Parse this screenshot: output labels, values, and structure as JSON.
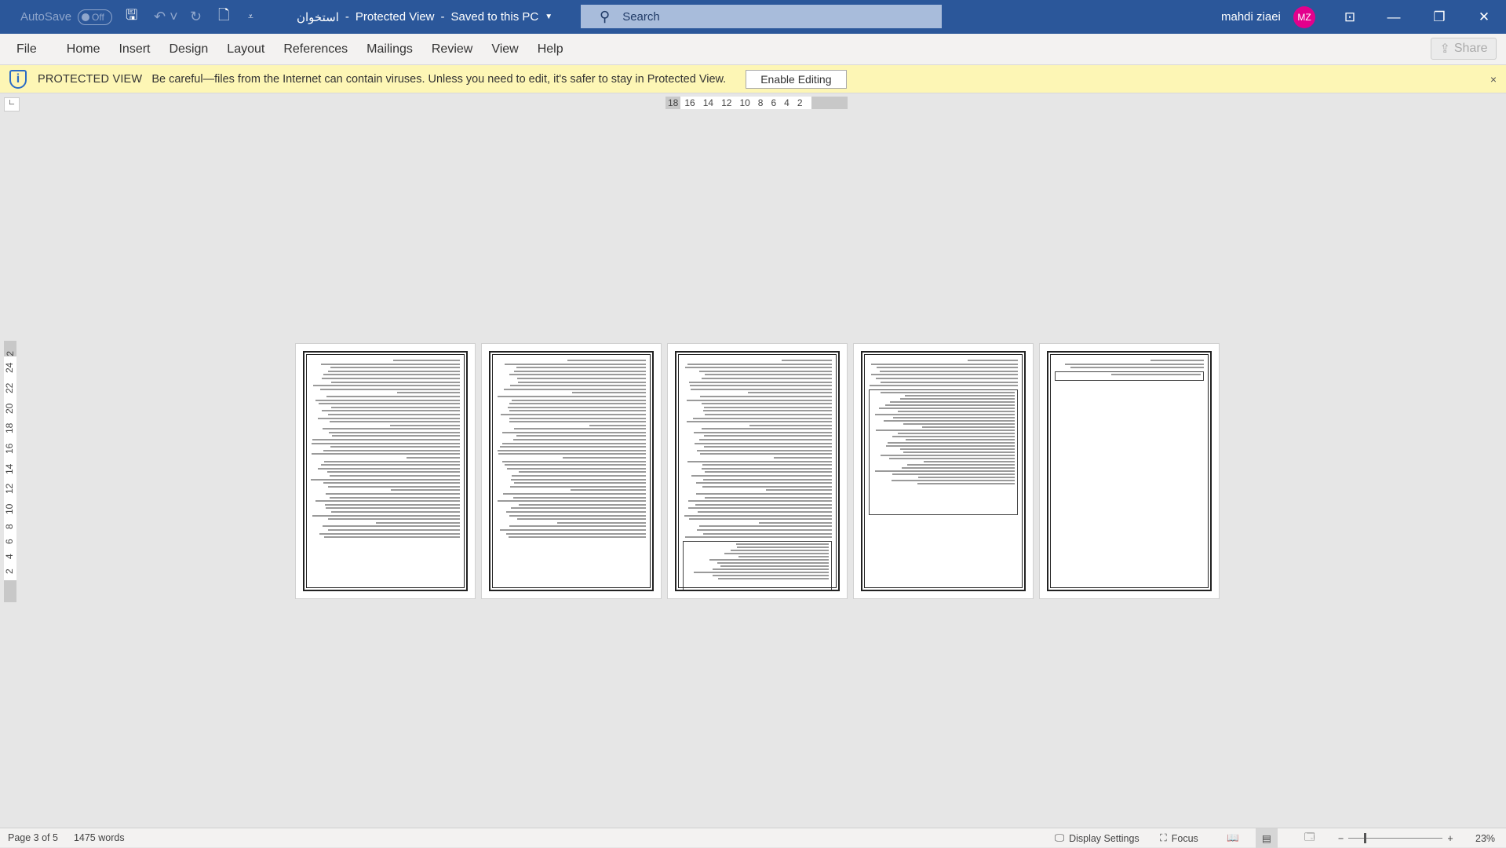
{
  "titlebar": {
    "autosave": "AutoSave",
    "autosave_state": "Off",
    "doc_title": "استخوان",
    "separator": "-",
    "view_mode": "Protected View",
    "save_state": "Saved to this PC",
    "search_placeholder": "Search",
    "user_name": "mahdi ziaei",
    "user_initials": "MZ",
    "avatar_color": "#e3008c"
  },
  "ribbon": {
    "tabs": [
      "File",
      "Home",
      "Insert",
      "Design",
      "Layout",
      "References",
      "Mailings",
      "Review",
      "View",
      "Help"
    ],
    "share": "Share"
  },
  "protected": {
    "label": "PROTECTED VIEW",
    "message": "Be careful—files from the Internet can contain viruses. Unless you need to edit, it's safer to stay in Protected View.",
    "enable": "Enable Editing",
    "close": "×"
  },
  "ruler": {
    "horizontal": [
      "18",
      "16",
      "14",
      "12",
      "10",
      "8",
      "6",
      "4",
      "2"
    ],
    "vertical": [
      "2",
      "2",
      "4",
      "6",
      "8",
      "10",
      "12",
      "14",
      "16",
      "18",
      "20",
      "22",
      "24"
    ]
  },
  "status": {
    "page": "Page 3 of 5",
    "words": "1475 words",
    "display_settings": "Display Settings",
    "focus": "Focus",
    "zoom": "23%",
    "current_page": 3,
    "total_pages": 5
  },
  "colors": {
    "titlebar": "#2b579a",
    "protected_bar": "#fdf6b5"
  }
}
